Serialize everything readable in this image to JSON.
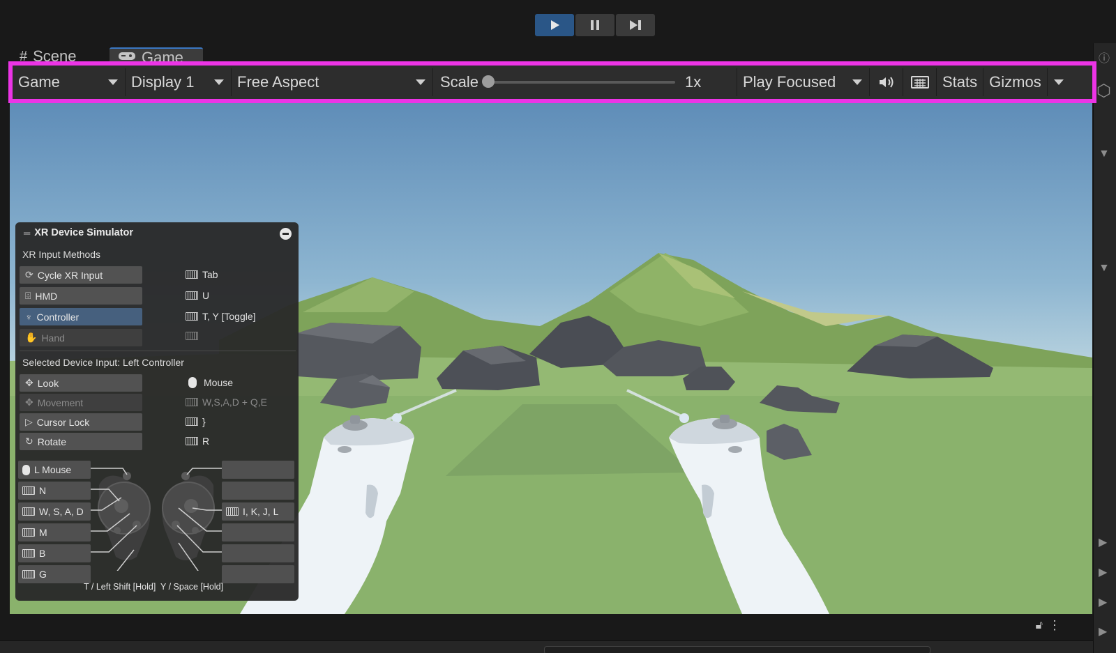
{
  "playbar": {
    "play": "play-icon",
    "pause": "pause-icon",
    "step": "step-icon"
  },
  "tabs": [
    {
      "label": "Scene",
      "icon": "grid-icon"
    },
    {
      "label": "Game",
      "icon": "gamepad-icon"
    }
  ],
  "toolbar": {
    "view": "Game",
    "display": "Display 1",
    "aspect": "Free Aspect",
    "scale_label": "Scale",
    "scale_value": "1x",
    "scale_level": 0,
    "play_mode": "Play Focused",
    "stats": "Stats",
    "gizmos": "Gizmos",
    "accent": "#ec34e6"
  },
  "xr": {
    "title": "XR Device Simulator",
    "input_methods_label": "XR Input Methods",
    "methods": [
      {
        "label": "Cycle XR Input",
        "key": "Tab",
        "icon": "cycle-icon"
      },
      {
        "label": "HMD",
        "key": "U",
        "icon": "headset-icon"
      },
      {
        "label": "Controller",
        "key": "T, Y [Toggle]",
        "icon": "controller-icon",
        "selected": true
      },
      {
        "label": "Hand",
        "key": "",
        "icon": "hand-icon",
        "disabled": true
      }
    ],
    "selected_label": "Selected Device Input: Left Controller",
    "inputs": [
      {
        "label": "Look",
        "key": "Mouse",
        "icon": "move-icon",
        "key_icon": "mouse-icon"
      },
      {
        "label": "Movement",
        "key": "W,S,A,D + Q,E",
        "icon": "move-icon",
        "disabled": true
      },
      {
        "label": "Cursor Lock",
        "key": "}",
        "icon": "cursor-icon"
      },
      {
        "label": "Rotate",
        "key": "R",
        "icon": "rotate-icon"
      }
    ],
    "left_buttons": [
      "L Mouse",
      "N",
      "W, S, A, D",
      "M",
      "B",
      "G"
    ],
    "right_buttons": [
      "",
      "",
      "I, K, J, L",
      "",
      "",
      ""
    ],
    "foot_left": "T / Left Shift [Hold]",
    "foot_right": "Y / Space [Hold]"
  }
}
